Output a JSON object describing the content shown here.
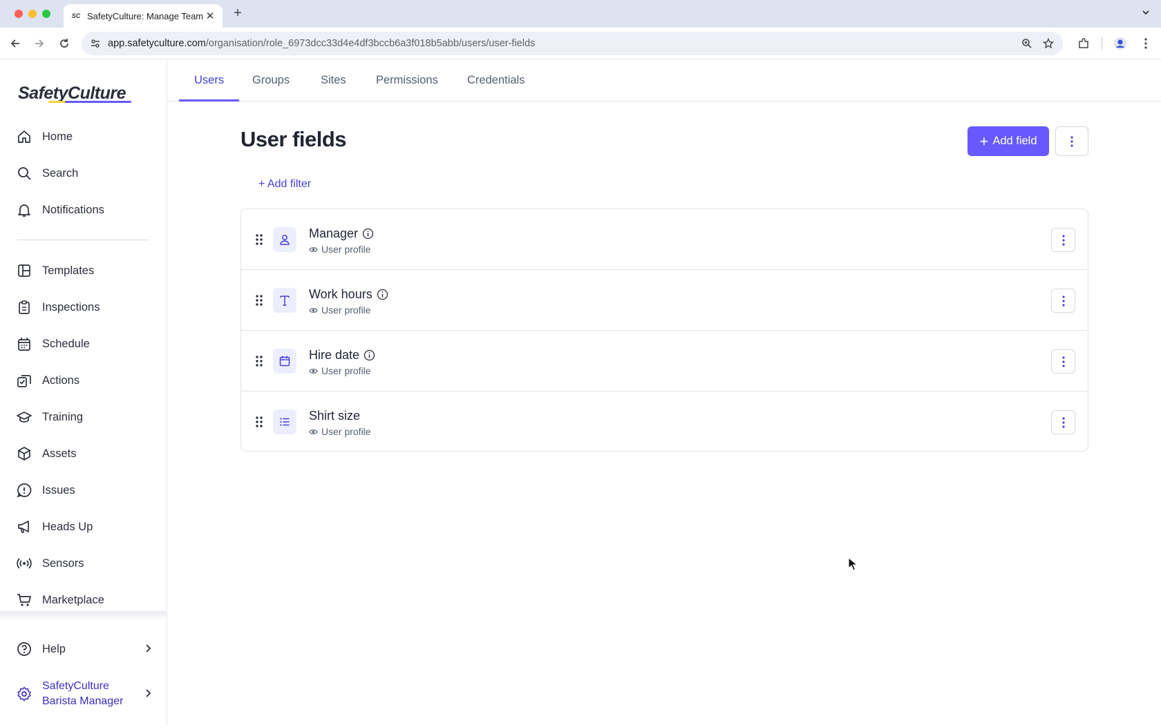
{
  "browser": {
    "tab_title": "SafetyCulture: Manage Teams",
    "tab_favicon": "SC",
    "url_host": "app.safetyculture.com",
    "url_path": "/organisation/role_6973dcc33d4e4df3bccb6a3f018b5abb/users/user-fields"
  },
  "sidebar": {
    "logo": "SafetyCulture",
    "items": [
      {
        "label": "Home",
        "icon": "home-icon"
      },
      {
        "label": "Search",
        "icon": "search-icon"
      },
      {
        "label": "Notifications",
        "icon": "bell-icon"
      },
      {
        "label": "Templates",
        "icon": "templates-icon"
      },
      {
        "label": "Inspections",
        "icon": "clipboard-icon"
      },
      {
        "label": "Schedule",
        "icon": "calendar-icon"
      },
      {
        "label": "Actions",
        "icon": "actions-icon"
      },
      {
        "label": "Training",
        "icon": "graduation-cap-icon"
      },
      {
        "label": "Assets",
        "icon": "cube-icon"
      },
      {
        "label": "Issues",
        "icon": "alert-icon"
      },
      {
        "label": "Heads Up",
        "icon": "megaphone-icon"
      },
      {
        "label": "Sensors",
        "icon": "sensor-icon"
      },
      {
        "label": "Marketplace",
        "icon": "cart-icon"
      }
    ],
    "help": "Help",
    "org_line1": "SafetyCulture",
    "org_line2": "Barista Manager"
  },
  "tabs": [
    {
      "label": "Users",
      "active": true
    },
    {
      "label": "Groups",
      "active": false
    },
    {
      "label": "Sites",
      "active": false
    },
    {
      "label": "Permissions",
      "active": false
    },
    {
      "label": "Credentials",
      "active": false
    }
  ],
  "page": {
    "title": "User fields",
    "add_field": "Add field",
    "add_filter": "+ Add filter"
  },
  "fields": [
    {
      "name": "Manager",
      "visibility": "User profile",
      "type_icon": "person-icon",
      "has_info": true
    },
    {
      "name": "Work hours",
      "visibility": "User profile",
      "type_icon": "text-icon",
      "has_info": true
    },
    {
      "name": "Hire date",
      "visibility": "User profile",
      "type_icon": "calendar-icon",
      "has_info": true
    },
    {
      "name": "Shirt size",
      "visibility": "User profile",
      "type_icon": "list-icon",
      "has_info": false
    }
  ],
  "colors": {
    "accent": "#6559ff",
    "accent_text": "#4740d4",
    "type_icon_bg": "#eceefe"
  }
}
